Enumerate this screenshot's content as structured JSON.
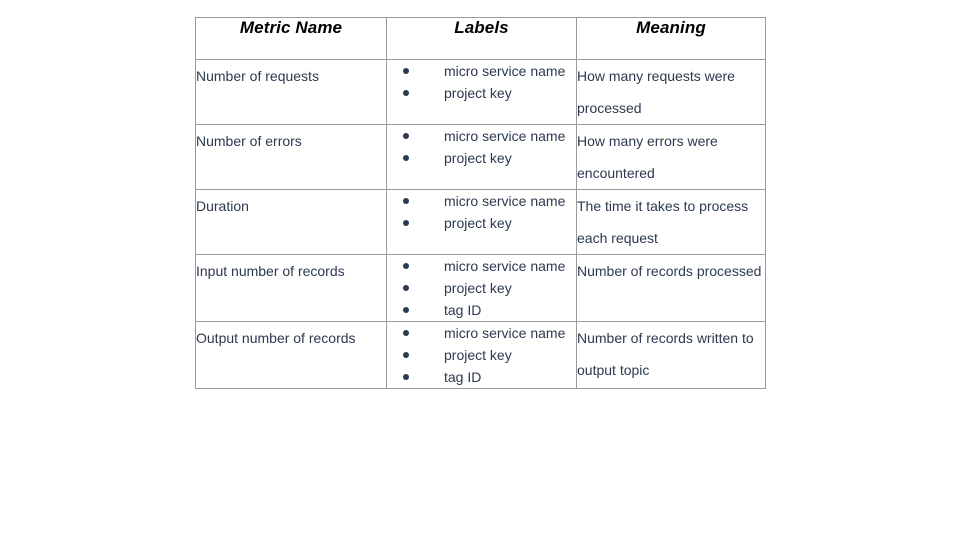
{
  "table": {
    "columns": [
      {
        "key": "metric_name",
        "label": "Metric Name"
      },
      {
        "key": "labels",
        "label": "Labels"
      },
      {
        "key": "meaning",
        "label": "Meaning"
      }
    ],
    "rows": [
      {
        "metric_name": "Number of requests",
        "labels": [
          "micro service name",
          "project key"
        ],
        "meaning": "How many requests were processed"
      },
      {
        "metric_name": "Number of errors",
        "labels": [
          "micro service name",
          "project key"
        ],
        "meaning": "How many errors were encountered"
      },
      {
        "metric_name": "Duration",
        "labels": [
          "micro service name",
          "project key"
        ],
        "meaning": "The time it takes to process each request"
      },
      {
        "metric_name": "Input number of records",
        "labels": [
          "micro service name",
          "project key",
          "tag ID"
        ],
        "meaning": "Number of records processed"
      },
      {
        "metric_name": "Output number of records",
        "labels": [
          "micro service name",
          "project key",
          "tag ID"
        ],
        "meaning": "Number of records written to output topic"
      }
    ]
  },
  "style": {
    "text_color": "#2c3a4f",
    "header_color": "#000000",
    "border_color": "#9a9a9a",
    "background": "#ffffff",
    "bullet_glyph": "bullet-icon"
  }
}
